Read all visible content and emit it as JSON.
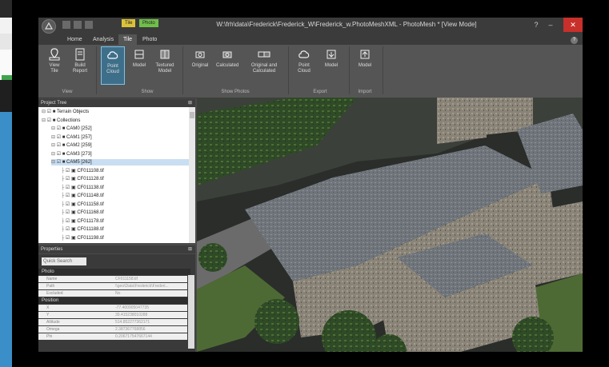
{
  "window": {
    "title": "W:\\frh\\data\\Frederick\\Frederick_W\\Frederick_w.PhotoMeshXML - PhotoMesh * [View Mode]",
    "context_tabs": [
      "Tile",
      "Photo"
    ]
  },
  "tabs": [
    "Home",
    "Analysis",
    "Tile",
    "Photo"
  ],
  "active_tab": "Tile",
  "ribbon": {
    "groups": [
      {
        "label": "View",
        "buttons": [
          "View\nTile",
          "Build\nReport"
        ]
      },
      {
        "label": "Show",
        "buttons": [
          "Point\nCloud",
          "Model",
          "Textured\nModel"
        ]
      },
      {
        "label": "Show Photos",
        "buttons": [
          "Original",
          "Calculated",
          "Original and\nCalculated"
        ]
      },
      {
        "label": "Export",
        "buttons": [
          "Point\nCloud",
          "Model"
        ]
      },
      {
        "label": "Import",
        "buttons": [
          "Model"
        ]
      }
    ]
  },
  "project_tree": {
    "title": "Project Tree",
    "rows": [
      {
        "label": "Terrain Objects",
        "indent": 0
      },
      {
        "label": "Collections",
        "indent": 0
      },
      {
        "label": "CAM0 [252]",
        "indent": 1
      },
      {
        "label": "CAM1 [257]",
        "indent": 1
      },
      {
        "label": "CAM2 [259]",
        "indent": 1
      },
      {
        "label": "CAM3 [273]",
        "indent": 1
      },
      {
        "label": "CAM5 [262]",
        "indent": 1,
        "selected": true
      },
      {
        "label": "CF011108.tif",
        "indent": 2
      },
      {
        "label": "CF011128.tif",
        "indent": 2
      },
      {
        "label": "CF011138.tif",
        "indent": 2
      },
      {
        "label": "CF011148.tif",
        "indent": 2
      },
      {
        "label": "CF011158.tif",
        "indent": 2
      },
      {
        "label": "CF011168.tif",
        "indent": 2
      },
      {
        "label": "CF011178.tif",
        "indent": 2
      },
      {
        "label": "CF011188.tif",
        "indent": 2
      },
      {
        "label": "CF011198.tif",
        "indent": 2
      }
    ]
  },
  "properties": {
    "title": "Properties",
    "search_placeholder": "Quick Search",
    "categories": [
      {
        "name": "Photo",
        "rows": [
          {
            "key": "Name",
            "value": "CF011158.tif"
          },
          {
            "key": "Path",
            "value": "\\\\geo\\Data\\Frederick\\Frederi..."
          },
          {
            "key": "Excluded",
            "value": "No"
          }
        ]
      },
      {
        "name": "Position",
        "rows": [
          {
            "key": "X",
            "value": "-77.400905047735"
          },
          {
            "key": "Y",
            "value": "39.415238010288"
          },
          {
            "key": "Altitude",
            "value": "514.852277362171"
          },
          {
            "key": "Omega",
            "value": "2.387367768856"
          },
          {
            "key": "Phi",
            "value": "0.206717547667144"
          }
        ]
      }
    ]
  },
  "icons": {
    "app_logo": "photomesh-logo-icon",
    "help": "help-icon"
  },
  "colors": {
    "accent": "#3e6f8a",
    "close": "#c8302b",
    "selection": "#c9def2"
  }
}
